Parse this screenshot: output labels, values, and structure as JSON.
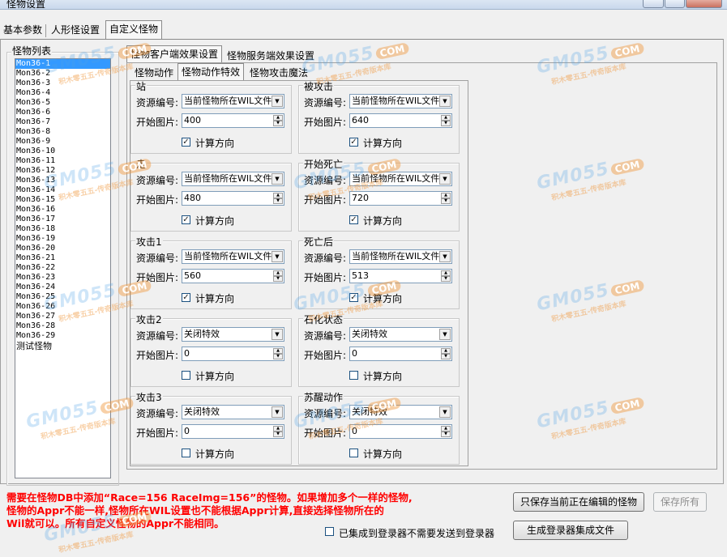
{
  "window": {
    "title": "怪物设置"
  },
  "main_tabs": [
    "基本参数",
    "人形怪设置",
    "自定义怪物"
  ],
  "monster_list": {
    "title": "怪物列表",
    "items": [
      "Mon36-1",
      "Mon36-2",
      "Mon36-3",
      "Mon36-4",
      "Mon36-5",
      "Mon36-6",
      "Mon36-7",
      "Mon36-8",
      "Mon36-9",
      "Mon36-10",
      "Mon36-11",
      "Mon36-12",
      "Mon36-13",
      "Mon36-14",
      "Mon36-15",
      "Mon36-16",
      "Mon36-17",
      "Mon36-18",
      "Mon36-19",
      "Mon36-20",
      "Mon36-21",
      "Mon36-22",
      "Mon36-23",
      "Mon36-24",
      "Mon36-25",
      "Mon36-26",
      "Mon36-27",
      "Mon36-28",
      "Mon36-29",
      "测试怪物"
    ],
    "selected_index": 0
  },
  "effect_tabs": [
    "怪物客户端效果设置",
    "怪物服务端效果设置"
  ],
  "sub_tabs": [
    "怪物动作",
    "怪物动作特效",
    "怪物攻击魔法"
  ],
  "labels": {
    "resource_no": "资源编号:",
    "start_image": "开始图片:",
    "calc_direction": "计算方向"
  },
  "groups": [
    {
      "title": "站",
      "resource": "当前怪物所在WIL文件",
      "start": "400",
      "calc": true
    },
    {
      "title": "被攻击",
      "resource": "当前怪物所在WIL文件",
      "start": "640",
      "calc": true
    },
    {
      "title": "走",
      "resource": "当前怪物所在WIL文件",
      "start": "480",
      "calc": true
    },
    {
      "title": "开始死亡",
      "resource": "当前怪物所在WIL文件",
      "start": "720",
      "calc": true
    },
    {
      "title": "攻击1",
      "resource": "当前怪物所在WIL文件",
      "start": "560",
      "calc": true
    },
    {
      "title": "死亡后",
      "resource": "当前怪物所在WIL文件",
      "start": "513",
      "calc": true
    },
    {
      "title": "攻击2",
      "resource": "关闭特效",
      "start": "0",
      "calc": false
    },
    {
      "title": "石化状态",
      "resource": "关闭特效",
      "start": "0",
      "calc": false
    },
    {
      "title": "攻击3",
      "resource": "关闭特效",
      "start": "0",
      "calc": false
    },
    {
      "title": "苏醒动作",
      "resource": "关闭特效",
      "start": "0",
      "calc": false
    }
  ],
  "note_lines": [
    "需要在怪物DB中添加“Race=156 RaceImg=156”的怪物。如果增加多个一样的怪物,",
    "怪物的Appr不能一样,怪物所在WIL设置也不能根据Appr计算,直接选择怪物所在的",
    "Wil就可以。所有自定义怪物的Appr不能相同。"
  ],
  "buttons": {
    "save_current": "只保存当前正在编辑的怪物",
    "save_all": "保存所有",
    "generate": "生成登录器集成文件"
  },
  "integrated_checkbox": {
    "label": "已集成到登录器不需要发送到登录器",
    "checked": false
  },
  "watermark": {
    "brand": "GM055",
    "com": "COM",
    "slogan": "积木零五五-传奇版本库"
  }
}
